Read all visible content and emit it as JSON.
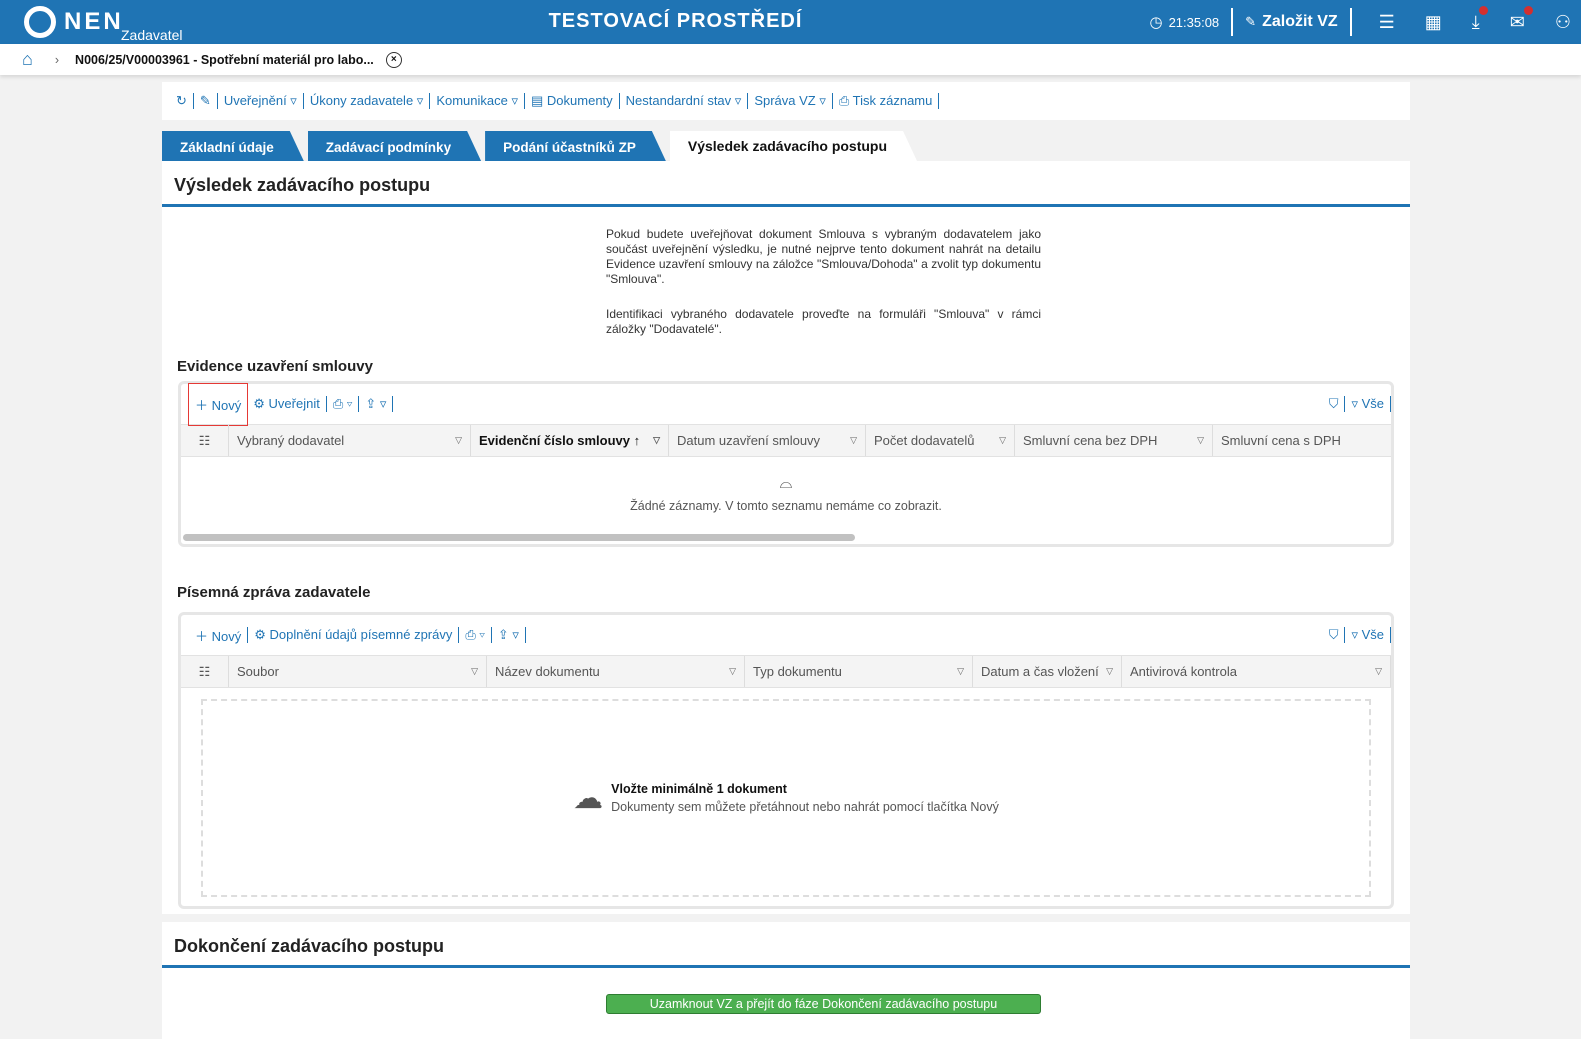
{
  "header": {
    "brand": "NEN",
    "role": "Zadavatel",
    "env": "TESTOVACÍ PROSTŘEDÍ",
    "time": "21:35:08",
    "create": "Založit VZ"
  },
  "breadcrumb": {
    "item": "N006/25/V00003961 - Spotřební materiál pro labo..."
  },
  "toolbar": [
    "Uveřejnění ▿",
    "Úkony zadavatele ▿",
    "Komunikace ▿",
    "Dokumenty",
    "Nestandardní stav ▿",
    "Správa VZ ▿",
    "Tisk záznamu"
  ],
  "tabs": [
    "Základní údaje",
    "Zadávací podmínky",
    "Podání účastníků ZP",
    "Výsledek zadávacího postupu"
  ],
  "section": {
    "title": "Výsledek zadávacího postupu",
    "info1": "Pokud budete uveřejňovat dokument Smlouva s vybraným dodavatelem jako součást uveřejnění výsledku, je nutné nejprve tento dokument nahrát na detailu Evidence uzavření smlouvy na záložce \"Smlouva/Dohoda\" a zvolit typ dokumentu \"Smlouva\".",
    "info2": "Identifikaci vybraného dodavatele proveďte na formuláři \"Smlouva\" v rámci záložky \"Dodavatelé\"."
  },
  "evidence": {
    "title": "Evidence uzavření smlouvy",
    "new": "Nový",
    "publish": "Uveřejnit",
    "all": "Vše",
    "columns": [
      "Vybraný dodavatel",
      "Evidenční číslo smlouvy",
      "Datum uzavření smlouvy",
      "Počet dodavatelů",
      "Smluvní cena bez DPH",
      "Smluvní cena s DPH"
    ],
    "empty": "Žádné záznamy. V tomto seznamu nemáme co zobrazit."
  },
  "report": {
    "title": "Písemná zpráva zadavatele",
    "new": "Nový",
    "fill": "Doplnění údajů písemné zprávy",
    "all": "Vše",
    "columns": [
      "Soubor",
      "Název dokumentu",
      "Typ dokumentu",
      "Datum a čas vložení",
      "Antivirová kontrola"
    ],
    "drop_title": "Vložte minimálně 1 dokument",
    "drop_hint": "Dokumenty sem můžete přetáhnout nebo nahrát pomocí tlačítka Nový"
  },
  "finish": {
    "title": "Dokončení zadávacího postupu",
    "button": "Uzamknout VZ a přejít do fáze Dokončení zadávacího postupu"
  }
}
